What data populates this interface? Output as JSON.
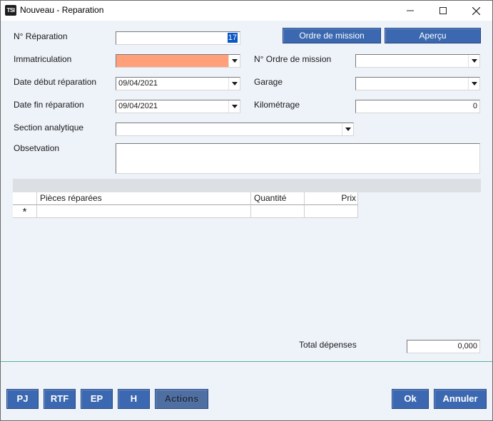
{
  "window": {
    "title": "Nouveau - Reparation",
    "app_icon_text": "TSI"
  },
  "form": {
    "num_reparation": {
      "label": "N° Réparation",
      "value": "17"
    },
    "immatriculation": {
      "label": "Immatriculation",
      "value": "",
      "highlight_color": "#ffa07a"
    },
    "date_debut": {
      "label": "Date début réparation",
      "value": "09/04/2021"
    },
    "date_fin": {
      "label": "Date fin réparation",
      "value": "09/04/2021"
    },
    "section_analytique": {
      "label": "Section analytique",
      "value": ""
    },
    "observation": {
      "label": "Obsetvation",
      "value": ""
    },
    "num_ordre_mission": {
      "label": "N° Ordre de mission",
      "value": ""
    },
    "garage": {
      "label": "Garage",
      "value": ""
    },
    "kilometrage": {
      "label": "Kilométrage",
      "value": "0"
    }
  },
  "top_buttons": {
    "ordre_mission": "Ordre de mission",
    "apercu": "Aperçu"
  },
  "grid": {
    "columns": [
      "Pièces réparées",
      "Quantité",
      "Prix"
    ],
    "new_row_marker": "*",
    "rows": []
  },
  "total": {
    "label": "Total dépenses",
    "value": "0,000"
  },
  "bottom_buttons": {
    "pj": "PJ",
    "rtf": "RTF",
    "ep": "EP",
    "h": "H",
    "actions": "Actions",
    "ok": "Ok",
    "annuler": "Annuler"
  },
  "colors": {
    "accent_button": "#3b68b0",
    "form_background": "#eef2f9",
    "separator": "#5bb39a"
  }
}
